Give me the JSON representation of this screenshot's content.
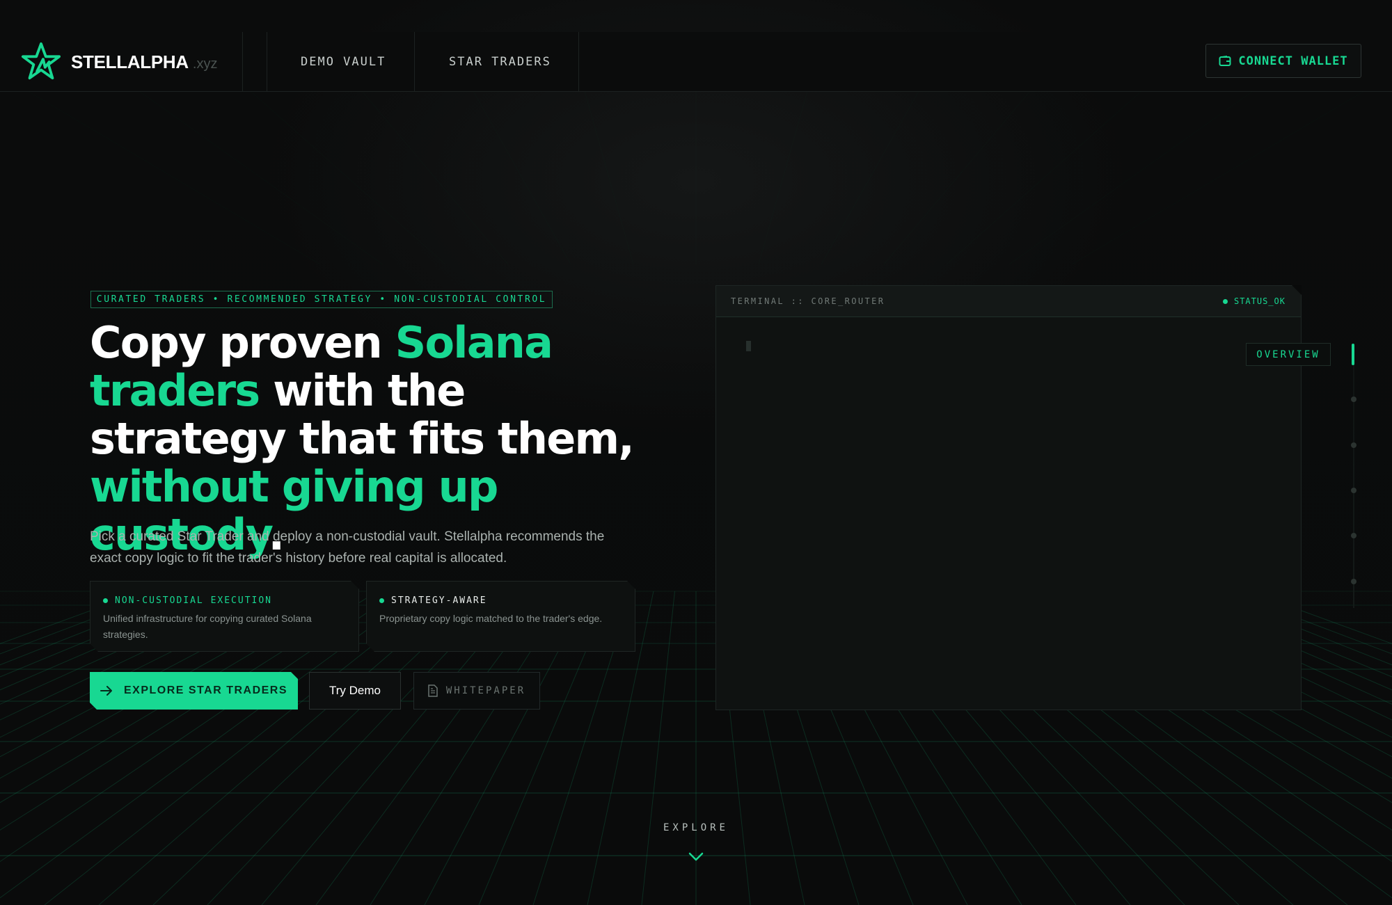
{
  "brand": {
    "name": "STELLALPHA",
    "tld": ".xyz",
    "accent_color": "#18d892",
    "background_color": "#090a0a"
  },
  "nav": {
    "items": [
      {
        "label": "DEMO VAULT"
      },
      {
        "label": "STAR TRADERS"
      }
    ],
    "connect_wallet": {
      "label": "CONNECT WALLET",
      "icon": "wallet-icon"
    }
  },
  "hero": {
    "tagline": "CURATED TRADERS • RECOMMENDED STRATEGY • NON-CUSTODIAL CONTROL",
    "headline": {
      "part1": "Copy proven ",
      "part2": "Solana traders",
      "part3": " with the strategy that fits them, ",
      "part4": "without giving up custody",
      "part5": "."
    },
    "subtext": "Pick a curated Star Trader and deploy a non-custodial vault. Stellalpha recommends the exact copy logic to fit the trader's history before real capital is allocated.",
    "features": [
      {
        "title": "NON-CUSTODIAL EXECUTION",
        "description": "Unified infrastructure for copying curated Solana strategies."
      },
      {
        "title": "STRATEGY-AWARE",
        "description": "Proprietary copy logic matched to the trader's edge."
      }
    ],
    "buttons": {
      "explore": {
        "label": "EXPLORE STAR TRADERS",
        "icon": "arrow-right-icon"
      },
      "demo": {
        "label": "Try Demo"
      },
      "whitepaper": {
        "label": "WHITEPAPER",
        "icon": "document-icon"
      }
    }
  },
  "terminal": {
    "title": "TERMINAL :: CORE_ROUTER",
    "status": "STATUS_OK",
    "tab": "OVERVIEW"
  },
  "footer": {
    "explore_label": "EXPLORE",
    "icon": "chevron-down-icon"
  }
}
